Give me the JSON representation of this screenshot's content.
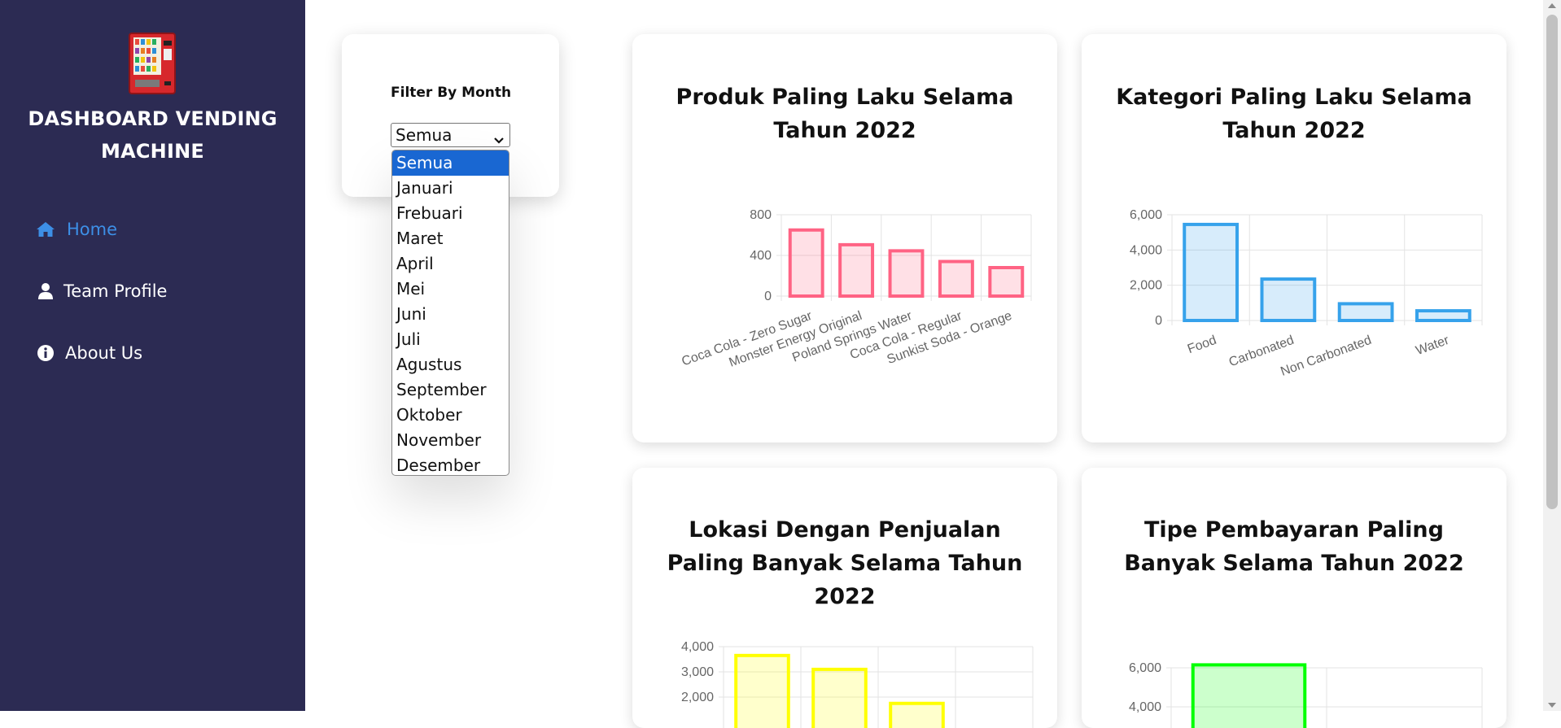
{
  "sidebar": {
    "title": "DASHBOARD VENDING MACHINE",
    "logo_icon": "vending-machine-icon",
    "nav": [
      {
        "label": "Home",
        "icon": "home-icon",
        "active": true
      },
      {
        "label": "Team Profile",
        "icon": "user-icon",
        "active": false
      },
      {
        "label": "About Us",
        "icon": "info-icon",
        "active": false
      }
    ]
  },
  "filter": {
    "label": "Filter By Month",
    "selected": "Semua",
    "options": [
      "Semua",
      "Januari",
      "Frebuari",
      "Maret",
      "April",
      "Mei",
      "Juni",
      "Juli",
      "Agustus",
      "September",
      "Oktober",
      "November",
      "Desember"
    ]
  },
  "colors": {
    "sidebar_bg": "#2c2b53",
    "nav_active": "#3d8fe6",
    "chart1": "#ff6384",
    "chart2": "#36a2eb",
    "chart3": "#ffff00",
    "chart4": "#00ff00"
  },
  "cards": [
    {
      "title": "Produk Paling Laku Selama Tahun 2022"
    },
    {
      "title": "Kategori Paling Laku Selama Tahun 2022"
    },
    {
      "title": "Lokasi Dengan Penjualan Paling Banyak Selama Tahun 2022"
    },
    {
      "title": "Tipe Pembayaran Paling Banyak Selama Tahun 2022"
    }
  ],
  "chart_data": [
    {
      "type": "bar",
      "categories": [
        "Coca Cola - Zero Sugar",
        "Monster Energy Original",
        "Poland Springs Water",
        "Coca Cola - Regular",
        "Sunkist Soda - Orange"
      ],
      "values": [
        650,
        505,
        445,
        340,
        280
      ],
      "ylim": [
        0,
        800
      ],
      "yticks": [
        0,
        400,
        800
      ],
      "ytick_labels": [
        "0",
        "400",
        "800"
      ],
      "grid": true
    },
    {
      "type": "bar",
      "categories": [
        "Food",
        "Carbonated",
        "Non Carbonated",
        "Water"
      ],
      "values": [
        5450,
        2350,
        950,
        550
      ],
      "ylim": [
        0,
        6000
      ],
      "yticks": [
        0,
        2000,
        4000,
        6000
      ],
      "ytick_labels": [
        "0",
        "2,000",
        "4,000",
        "6,000"
      ],
      "grid": true
    },
    {
      "type": "bar",
      "categories": [
        "",
        "",
        "",
        ""
      ],
      "values": [
        3650,
        3100,
        1750,
        0
      ],
      "ylim": [
        0,
        4000
      ],
      "yticks": [
        2000,
        3000,
        4000
      ],
      "ytick_labels": [
        "2,000",
        "3,000",
        "4,000"
      ],
      "grid": true
    },
    {
      "type": "bar",
      "categories": [
        "",
        ""
      ],
      "values": [
        6150,
        0
      ],
      "ylim": [
        0,
        7000
      ],
      "yticks": [
        4000,
        6000
      ],
      "ytick_labels": [
        "4,000",
        "6,000"
      ],
      "grid": true
    }
  ]
}
